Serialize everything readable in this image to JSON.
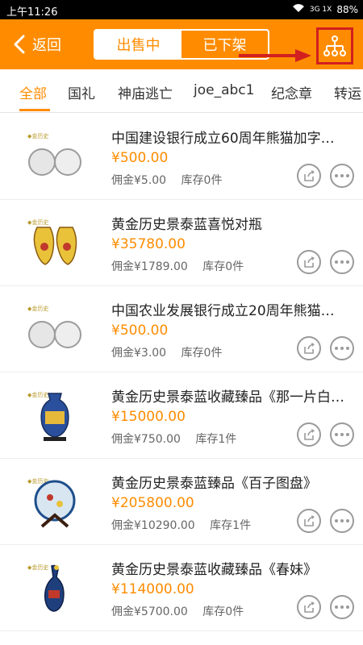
{
  "status_bar": {
    "time": "上午11:26",
    "network": "3G 1X",
    "battery": "88%"
  },
  "header": {
    "back_label": "返回",
    "segments": [
      "出售中",
      "已下架"
    ],
    "active_segment": 0
  },
  "tabs": [
    "全部",
    "国礼",
    "神庙逃亡",
    "joe_abc1",
    "纪念章",
    "转运"
  ],
  "active_tab": 0,
  "items": [
    {
      "title": "中国建设银行成立60周年熊猫加字纪念币",
      "price": "¥500.00",
      "commission": "佣金¥5.00",
      "stock": "库存0件",
      "thumb": "coins-icon"
    },
    {
      "title": "黄金历史景泰蓝喜悦对瓶",
      "price": "¥35780.00",
      "commission": "佣金¥1789.00",
      "stock": "库存0件",
      "thumb": "vases-icon"
    },
    {
      "title": "中国农业发展银行成立20周年熊猫加字纪念币",
      "price": "¥500.00",
      "commission": "佣金¥3.00",
      "stock": "库存0件",
      "thumb": "coins-icon"
    },
    {
      "title": "黄金历史景泰蓝收藏臻品《那一片白云》",
      "price": "¥15000.00",
      "commission": "佣金¥750.00",
      "stock": "库存1件",
      "thumb": "vase-icon"
    },
    {
      "title": "黄金历史景泰蓝臻品《百子图盘》",
      "price": "¥205800.00",
      "commission": "佣金¥10290.00",
      "stock": "库存1件",
      "thumb": "plate-icon"
    },
    {
      "title": "黄金历史景泰蓝收藏臻品《春妹》",
      "price": "¥114000.00",
      "commission": "佣金¥5700.00",
      "stock": "库存0件",
      "thumb": "figurine-icon"
    }
  ],
  "colors": {
    "accent": "#ff8c00",
    "highlight": "#d21f1f"
  }
}
